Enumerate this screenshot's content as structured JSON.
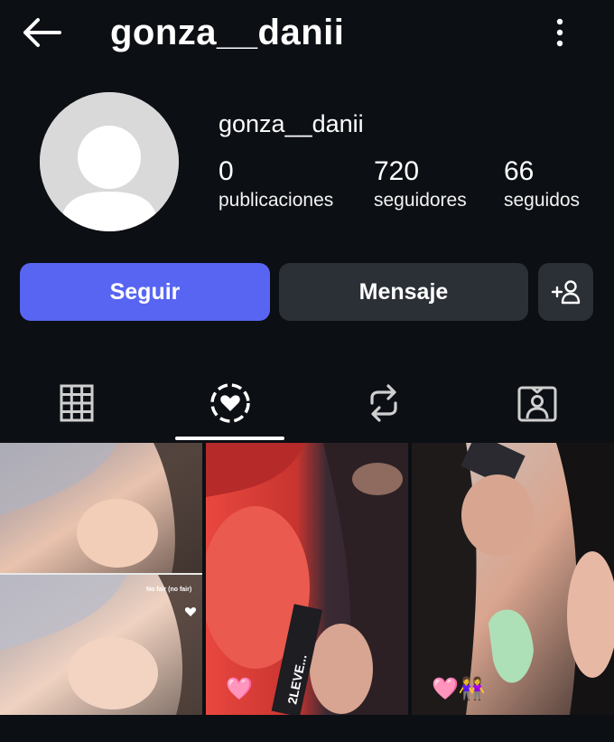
{
  "header": {
    "title": "gonza__danii",
    "back_icon": "arrow-left-icon",
    "menu_icon": "more-vertical-icon"
  },
  "profile": {
    "username": "gonza__danii",
    "avatar_icon": "default-avatar-icon",
    "stats": [
      {
        "value": "0",
        "label": "publicaciones"
      },
      {
        "value": "720",
        "label": "seguidores"
      },
      {
        "value": "66",
        "label": "seguidos"
      }
    ]
  },
  "actions": {
    "follow_label": "Seguir",
    "message_label": "Mensaje",
    "add_user_icon": "add-user-icon"
  },
  "tabs": [
    {
      "icon": "grid-icon",
      "active": false
    },
    {
      "icon": "highlights-icon",
      "active": true
    },
    {
      "icon": "reposts-icon",
      "active": false
    },
    {
      "icon": "tagged-icon",
      "active": false
    }
  ],
  "grid": {
    "items": [
      {
        "overlay_text": "No fair (no fair)",
        "emoji": ""
      },
      {
        "overlay_text": "2LEVE...",
        "emoji": "🩷"
      },
      {
        "overlay_text": "",
        "emoji": "🩷👭"
      }
    ]
  },
  "colors": {
    "background": "#0c0f14",
    "accent": "#5865f2",
    "button_secondary": "#2b2f36",
    "avatar": "#d9d9d9"
  }
}
